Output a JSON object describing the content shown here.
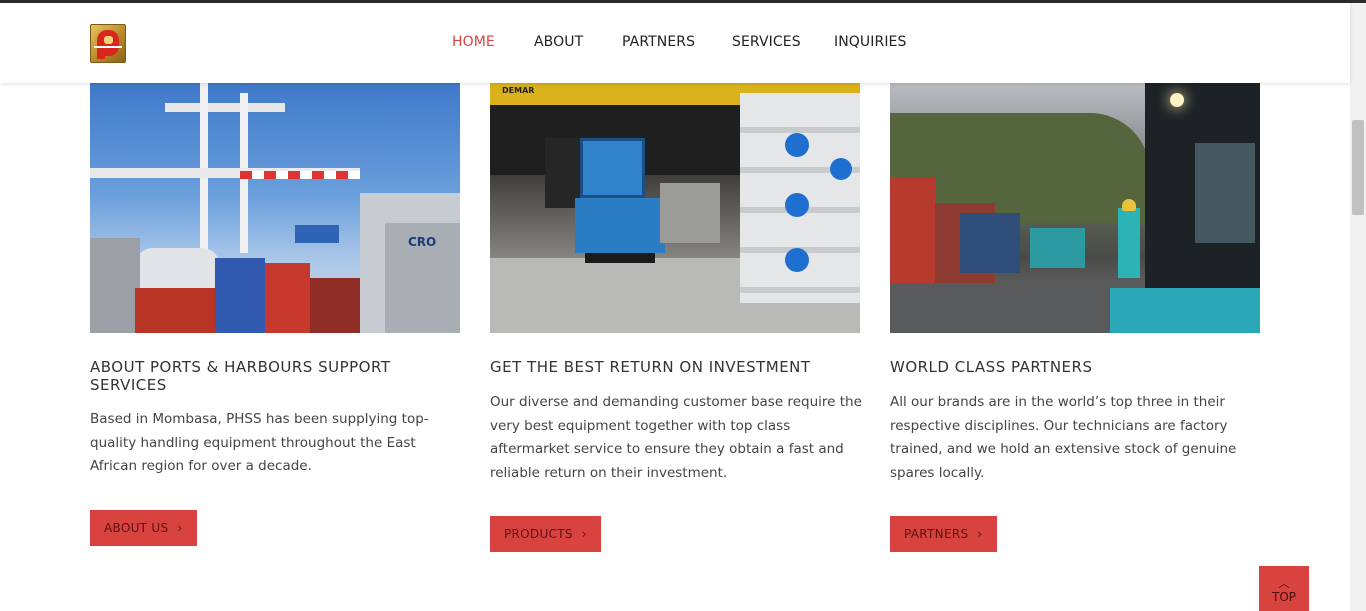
{
  "nav": {
    "items": [
      {
        "label": "HOME",
        "active": true
      },
      {
        "label": "ABOUT",
        "active": false
      },
      {
        "label": "PARTNERS",
        "active": false
      },
      {
        "label": "SERVICES",
        "active": false
      },
      {
        "label": "INQUIRIES",
        "active": false
      }
    ]
  },
  "cards": [
    {
      "title": "ABOUT PORTS & HARBOURS SUPPORT SERVICES",
      "text": "Based in Mombasa, PHSS has been supplying top-quality handling equipment throughout the East African region for over a decade.",
      "button": "ABOUT US",
      "photo_overlay": "CRO"
    },
    {
      "title": "GET THE BEST RETURN ON INVESTMENT",
      "text": "Our diverse and demanding customer base require the very best equipment together with top class aftermarket service to ensure they obtain a fast and reliable return on their investment.",
      "button": "PRODUCTS",
      "photo_overlay": "DEMAR"
    },
    {
      "title": "WORLD CLASS PARTNERS",
      "text": "All our brands are in the world’s top three in their respective disciplines. Our technicians are factory trained, and we hold an extensive stock of genuine spares locally.",
      "button": "PARTNERS"
    }
  ],
  "top_button": {
    "label": "TOP",
    "icon": "chevron-up-icon"
  },
  "colors": {
    "accent": "#d9433f",
    "text": "#333333",
    "header_bg": "#ffffff"
  }
}
